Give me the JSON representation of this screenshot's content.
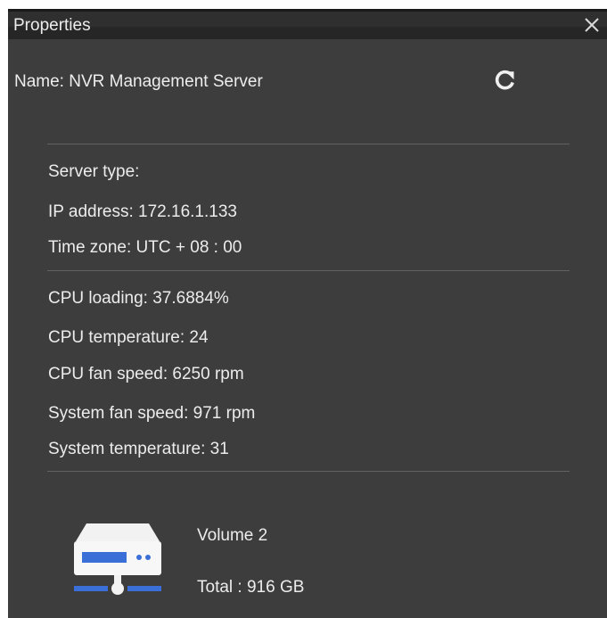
{
  "window": {
    "title": "Properties"
  },
  "server": {
    "name_label": "Name:",
    "name_value": "NVR Management Server"
  },
  "info": {
    "server_type": "Server type:",
    "ip_address": "IP address: 172.16.1.133",
    "time_zone": "Time zone: UTC + 08 : 00"
  },
  "status": {
    "cpu_loading": "CPU loading: 37.6884%",
    "cpu_temperature": "CPU temperature: 24",
    "cpu_fan_speed": "CPU fan speed: 6250 rpm",
    "system_fan_speed": "System fan speed: 971 rpm",
    "system_temperature": "System temperature: 31"
  },
  "volume": {
    "name": "Volume 2",
    "total": "Total : 916 GB"
  },
  "colors": {
    "panel_bg": "#3d3d3d",
    "titlebar_bg": "#2f2f2f",
    "text": "#ececec",
    "divider": "#626262",
    "drive_accent": "#3a6fd8"
  },
  "icons": {
    "close": "close-icon",
    "refresh": "refresh-icon",
    "volume": "network-drive-icon"
  }
}
